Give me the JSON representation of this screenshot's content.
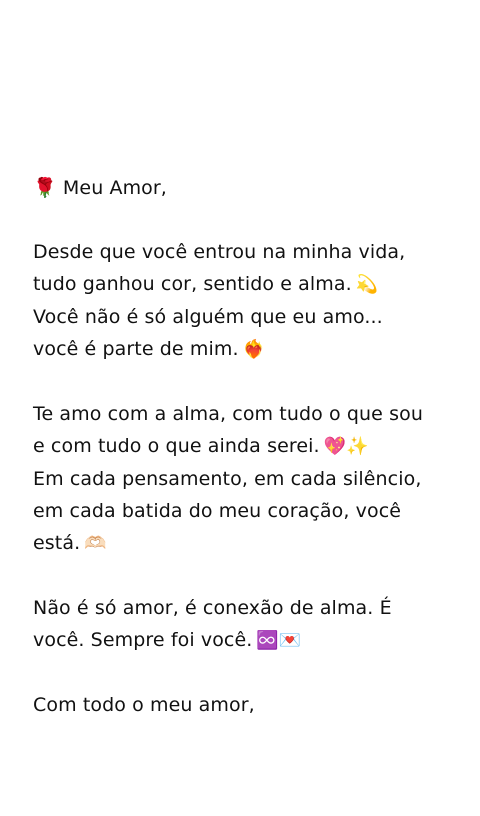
{
  "message": {
    "greeting": {
      "emoji": "🌹",
      "text": "Meu Amor,"
    },
    "paragraph1": [
      {
        "text": "Desde que você entrou na minha vida,",
        "emoji": ""
      },
      {
        "text": "tudo ganhou cor, sentido e alma.",
        "emoji": "💫"
      },
      {
        "text": "Você não é só alguém que eu amo...",
        "emoji": ""
      },
      {
        "text": "você é parte de mim.",
        "emoji": "❤️‍🔥"
      }
    ],
    "paragraph2": [
      {
        "text": "Te amo com a alma, com tudo o que sou",
        "emoji": ""
      },
      {
        "text": "e com tudo o que ainda serei.",
        "emoji": "💖✨"
      },
      {
        "text": "Em cada pensamento, em cada silêncio,",
        "emoji": ""
      },
      {
        "text": "em cada batida do meu coração, você",
        "emoji": ""
      },
      {
        "text": "está.",
        "emoji": "🫶🏻"
      }
    ],
    "paragraph3": [
      {
        "text": "Não é só amor, é conexão de alma. É",
        "emoji": ""
      },
      {
        "text": "você. Sempre foi você.",
        "emoji": "♾️💌"
      }
    ],
    "closing": "Com todo o meu amor,"
  }
}
